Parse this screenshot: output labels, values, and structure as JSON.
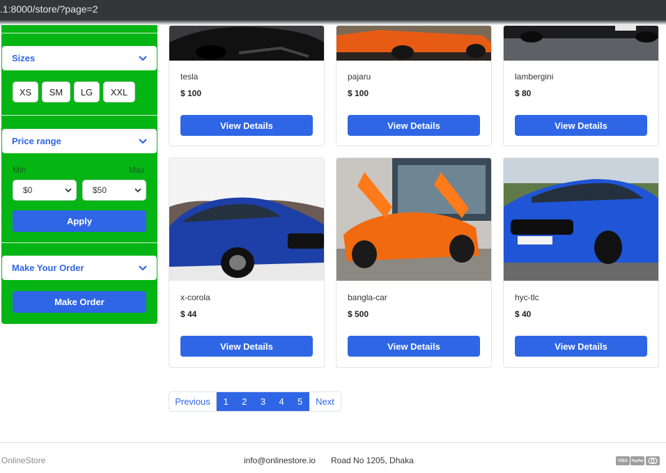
{
  "browser": {
    "url": ".1:8000/store/?page=2"
  },
  "sidebar": {
    "sizes": {
      "title": "Sizes",
      "options": [
        "XS",
        "SM",
        "LG",
        "XXL"
      ]
    },
    "price": {
      "title": "Price range",
      "min_label": "Min",
      "max_label": "Max",
      "min_value": "$0",
      "max_value": "$50",
      "apply_label": "Apply"
    },
    "order": {
      "title": "Make Your Order",
      "button_label": "Make Order"
    }
  },
  "products": [
    {
      "name": "tesla",
      "price": "$ 100",
      "button": "View Details",
      "image": "black-car-image"
    },
    {
      "name": "pajaru",
      "price": "$ 100",
      "button": "View Details",
      "image": "orange-car-image"
    },
    {
      "name": "lambergini",
      "price": "$ 80",
      "button": "View Details",
      "image": "dark-car-image"
    },
    {
      "name": "x-corola",
      "price": "$ 44",
      "button": "View Details",
      "image": "blue-audi-image"
    },
    {
      "name": "bangla-car",
      "price": "$ 500",
      "button": "View Details",
      "image": "orange-mclaren-image"
    },
    {
      "name": "hyc-tlc",
      "price": "$ 40",
      "button": "View Details",
      "image": "blue-bmw-image"
    }
  ],
  "pagination": {
    "previous": "Previous",
    "pages": [
      "1",
      "2",
      "3",
      "4",
      "5"
    ],
    "next": "Next"
  },
  "footer": {
    "brand": "OnlineStore",
    "email": "info@onlinestore.io",
    "address": "Road No 1205, Dhaka",
    "payments": [
      "VISA",
      "PayPal",
      "mastercard-icon"
    ]
  },
  "colors": {
    "primary": "#2f66e5",
    "sidebar_green": "#05b514"
  }
}
